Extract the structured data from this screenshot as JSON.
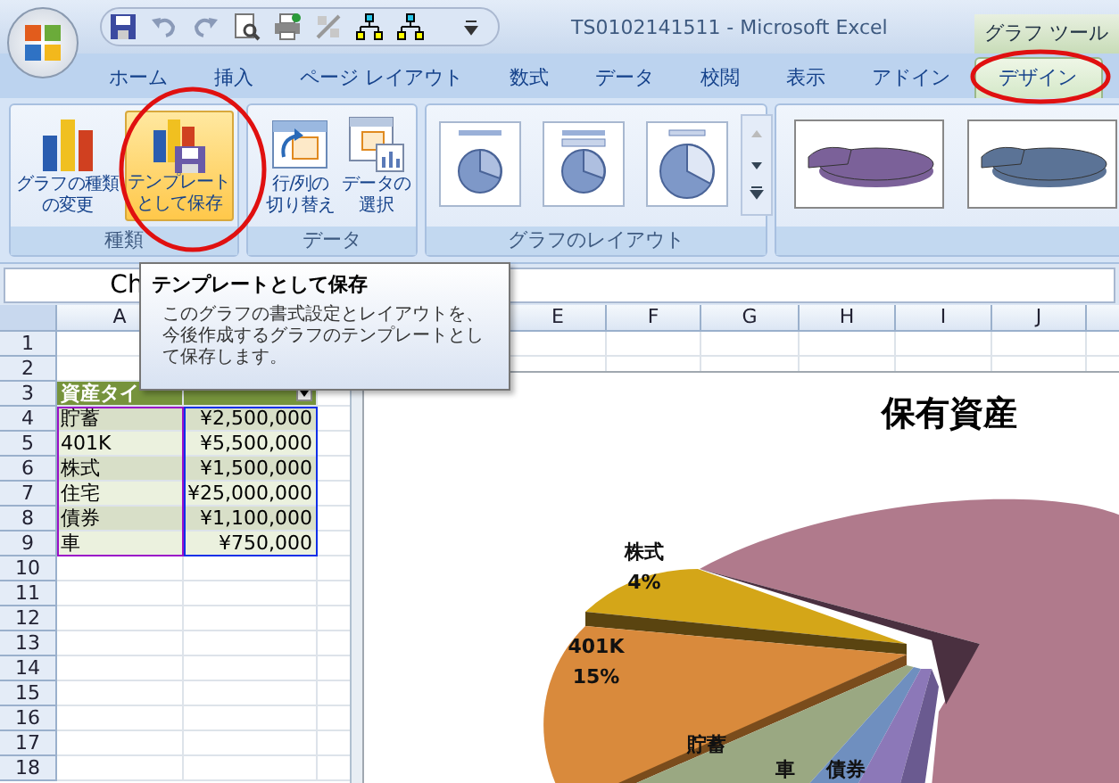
{
  "window": {
    "title": "TS0102141511 - Microsoft Excel",
    "context_tab": "グラフ ツール"
  },
  "tabs": [
    {
      "label": "ホーム",
      "selected": false
    },
    {
      "label": "挿入",
      "selected": false
    },
    {
      "label": "ページ レイアウト",
      "selected": false
    },
    {
      "label": "数式",
      "selected": false
    },
    {
      "label": "データ",
      "selected": false
    },
    {
      "label": "校閲",
      "selected": false
    },
    {
      "label": "表示",
      "selected": false
    },
    {
      "label": "アドイン",
      "selected": false
    },
    {
      "label": "デザイン",
      "selected": true
    }
  ],
  "ribbon": {
    "groups": [
      {
        "kind": "buttons",
        "label": "種類",
        "buttons": [
          {
            "kind": "chart-type",
            "lines": [
              "グラフの種類",
              "の変更"
            ],
            "hovered": false
          },
          {
            "kind": "save-template",
            "lines": [
              "テンプレート",
              "として保存"
            ],
            "hovered": true
          }
        ]
      },
      {
        "kind": "buttons",
        "label": "データ",
        "buttons": [
          {
            "kind": "switch",
            "lines": [
              "行/列の",
              "切り替え"
            ],
            "hovered": false
          },
          {
            "kind": "select-data",
            "lines": [
              "データの",
              "選択"
            ],
            "hovered": false
          }
        ]
      },
      {
        "kind": "layouts",
        "label": "グラフのレイアウト",
        "items": [
          {
            "kind": "title-labels"
          },
          {
            "kind": "title-percent"
          },
          {
            "kind": "legend-bottom"
          }
        ]
      },
      {
        "kind": "styles",
        "items": [
          {
            "color": "#7b6199"
          },
          {
            "color": "#5b7396"
          }
        ]
      }
    ]
  },
  "name_box": "Ch",
  "tooltip": {
    "title": "テンプレートとして保存",
    "body": "このグラフの書式設定とレイアウトを、今後作成するグラフのテンプレートとして保存します。"
  },
  "sheet": {
    "columns": [
      "A",
      "E",
      "F",
      "G",
      "H",
      "I",
      "J"
    ],
    "row_numbers": [
      "1",
      "2",
      "3",
      "4",
      "5",
      "6",
      "7",
      "8",
      "9",
      "10",
      "11",
      "12",
      "13",
      "14",
      "15",
      "16",
      "17",
      "18"
    ],
    "table_header": "資産タイ",
    "table_rows": [
      {
        "type": "貯蓄",
        "amount": "¥2,500,000"
      },
      {
        "type": "401K",
        "amount": "¥5,500,000"
      },
      {
        "type": "株式",
        "amount": "¥1,500,000"
      },
      {
        "type": "住宅",
        "amount": "¥25,000,000"
      },
      {
        "type": "債券",
        "amount": "¥1,100,000"
      },
      {
        "type": "車",
        "amount": "¥750,000"
      }
    ]
  },
  "chart": {
    "title": "保有資産",
    "labels": [
      {
        "name": "株式",
        "percent": "4%"
      },
      {
        "name": "401K",
        "percent": "15%"
      },
      {
        "name": "貯蓄"
      },
      {
        "name": "車"
      },
      {
        "name": "債券"
      }
    ]
  },
  "annotations": [
    {
      "kind": "ellipse"
    },
    {
      "kind": "ellipse"
    }
  ]
}
